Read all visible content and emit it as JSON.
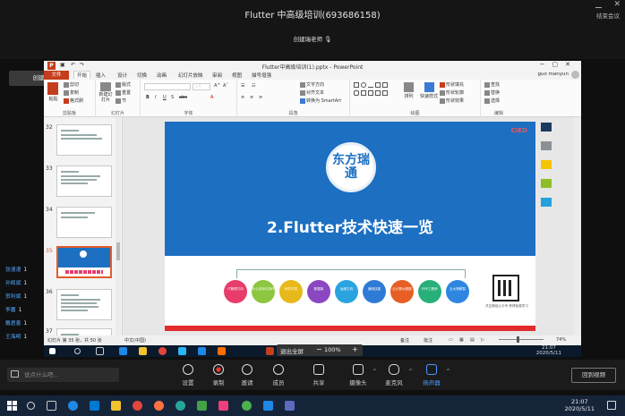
{
  "meeting": {
    "title": "Flutter 中高级培训(693686158)",
    "end_label": "结束会议",
    "host_label": "创建瑞老师",
    "share_tag": "创建瑞老师的屏幕",
    "participants": [
      {
        "name": "张漫漫",
        "count": "1"
      },
      {
        "name": "孙辉斌",
        "count": "1"
      },
      {
        "name": "贺利斌",
        "count": "1"
      },
      {
        "name": "李嘉",
        "count": "1"
      },
      {
        "name": "戴君善",
        "count": "1"
      },
      {
        "name": "王海明",
        "count": "1"
      }
    ]
  },
  "ppt": {
    "title": "Flutter中高级培训(1).pptx - PowerPoint",
    "logo": "P",
    "user": "guo manyun",
    "tabs": [
      "文件",
      "开始",
      "插入",
      "设计",
      "切换",
      "动画",
      "幻灯片放映",
      "审阅",
      "视图",
      "描号增强"
    ],
    "active_tab": "开始",
    "groups": {
      "clipboard": "剪贴板",
      "slides": "幻灯片",
      "font": "字体",
      "paragraph": "段落",
      "drawing": "绘图",
      "editing": "编辑"
    },
    "ribbon_buttons": {
      "paste": "粘贴",
      "cut": "剪切",
      "copy": "复制",
      "format_painter": "格式刷",
      "new_slide": "新建幻灯片",
      "layout": "版式",
      "reset": "重置",
      "section": "节",
      "font_size": "14",
      "text_dir": "文字方向",
      "align_text": "对齐文本",
      "smartart": "转换为 SmartArt",
      "arrange": "排列",
      "quick_styles": "快速样式",
      "shape_fill": "形状填充",
      "shape_outline": "形状轮廓",
      "shape_effects": "形状效果",
      "find": "查找",
      "replace": "替换",
      "select": "选择"
    },
    "thumb_numbers": [
      "32",
      "33",
      "34",
      "35",
      "36",
      "37"
    ],
    "slide": {
      "corner": "CIED",
      "logo": "东方瑞通",
      "title": "2.Flutter技术快速一览",
      "circles": [
        {
          "label": "IT管理方向",
          "color": "#e83c6a"
        },
        {
          "label": "办公应用与协作",
          "color": "#8dc63f"
        },
        {
          "label": "软件开发",
          "color": "#e7b91a"
        },
        {
          "label": "数据库",
          "color": "#8b47c2"
        },
        {
          "label": "运维方向",
          "color": "#2aa4e0"
        },
        {
          "label": "通用技能",
          "color": "#2e7bd6"
        },
        {
          "label": "云计算大数据",
          "color": "#e85f25"
        },
        {
          "label": "ERP工程师",
          "color": "#27b07a"
        },
        {
          "label": "云大物移智",
          "color": "#2f86e0"
        }
      ],
      "qr_text": "关注微信公众号 获得免费学习",
      "swatch_colors": [
        "#1f3a60",
        "#8b8f96",
        "#f5c400",
        "#8dbf24",
        "#26a0da"
      ]
    },
    "status": {
      "slide_info": "幻灯片 第 35 张，共 50 张",
      "language": "中文(中国)",
      "notes": "备注",
      "comments": "批注",
      "zoom": "74%"
    }
  },
  "zoom_pill": {
    "exit_fullscreen": "退出全屏",
    "minus": "−",
    "value": "100%",
    "plus": "+"
  },
  "inner_clock": {
    "time": "21:07",
    "date": "2020/5/11"
  },
  "toolbar": {
    "chat_placeholder": "说点什么吧...",
    "buttons": [
      "设置",
      "录制",
      "邀请",
      "成员",
      "共享",
      "摄像头",
      "麦克风",
      "扬声器"
    ],
    "return_video": "回到视频"
  },
  "host_clock": {
    "time": "21:07",
    "date": "2020/5/11"
  }
}
